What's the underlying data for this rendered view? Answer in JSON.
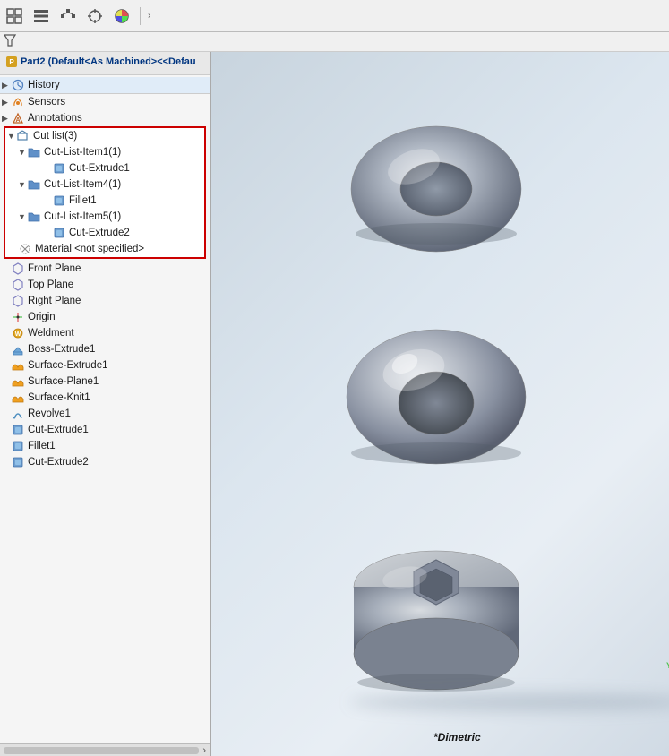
{
  "toolbar": {
    "icons": [
      "⊞",
      "≡",
      "≣",
      "✛",
      "◉"
    ],
    "chevron": "›"
  },
  "filter": {
    "icon": "⊿"
  },
  "part_header": {
    "text": "Part2 (Default<As Machined><<Defau"
  },
  "tree": {
    "history_label": "History",
    "sensors_label": "Sensors",
    "annotations_label": "Annotations",
    "cut_list_label": "Cut list(3)",
    "cut_list_items": [
      {
        "label": "Cut-List-Item1(1)",
        "children": [
          "Cut-Extrude1"
        ]
      },
      {
        "label": "Cut-List-Item4(1)",
        "children": [
          "Fillet1"
        ]
      },
      {
        "label": "Cut-List-Item5(1)",
        "children": [
          "Cut-Extrude2"
        ]
      }
    ],
    "material_label": "Material <not specified>",
    "front_plane_label": "Front Plane",
    "top_plane_label": "Top Plane",
    "right_plane_label": "Right Plane",
    "origin_label": "Origin",
    "weldment_label": "Weldment",
    "boss_extrude1_label": "Boss-Extrude1",
    "surface_extrude1_label": "Surface-Extrude1",
    "surface_plane1_label": "Surface-Plane1",
    "surface_knit1_label": "Surface-Knit1",
    "revolve1_label": "Revolve1",
    "cut_extrude1_label": "Cut-Extrude1",
    "fillet1_label": "Fillet1",
    "cut_extrude2_label": "Cut-Extrude2"
  },
  "viewport": {
    "dimetric_label": "*Dimetric"
  }
}
